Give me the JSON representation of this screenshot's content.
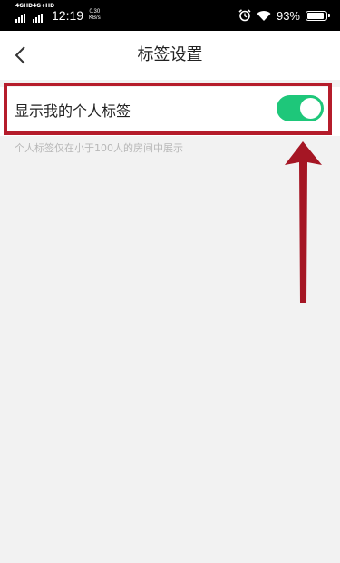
{
  "status_bar": {
    "signal1_label": "4GHD",
    "signal2_label": "4G+HD",
    "time": "12:19",
    "speed_value": "0.30",
    "speed_unit": "KB/s",
    "battery_percent": "93%",
    "battery_level": 0.93,
    "icons": [
      "alarm-icon",
      "wifi-icon",
      "battery-icon"
    ]
  },
  "nav": {
    "title": "标签设置",
    "back_icon": "chevron-left-icon"
  },
  "settings": {
    "show_tag_label": "显示我的个人标签",
    "show_tag_enabled": true,
    "hint": "个人标签仅在小于100人的房间中展示"
  },
  "annotation": {
    "highlight_color": "#b51c2b",
    "arrow_color": "#a51624"
  },
  "colors": {
    "toggle_on": "#1ec77a",
    "background": "#f2f2f2"
  }
}
